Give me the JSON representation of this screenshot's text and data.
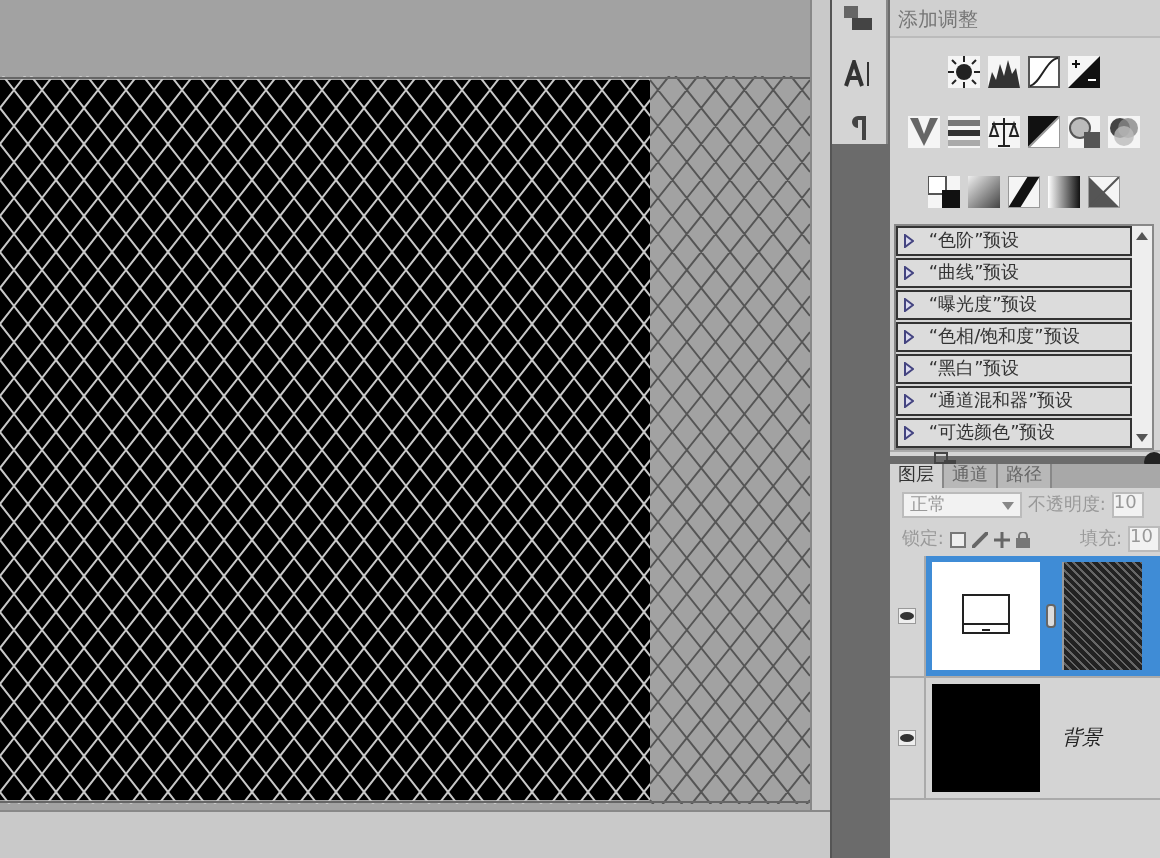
{
  "adjustments": {
    "title": "添加调整",
    "presets": [
      {
        "label": "“色阶”预设"
      },
      {
        "label": "“曲线”预设"
      },
      {
        "label": "“曝光度”预设"
      },
      {
        "label": "“色相/饱和度”预设"
      },
      {
        "label": "“黑白”预设"
      },
      {
        "label": "“通道混和器”预设"
      },
      {
        "label": "“可选颜色”预设"
      }
    ]
  },
  "layers_panel": {
    "tabs": [
      {
        "label": "图层",
        "selected": true
      },
      {
        "label": "通道",
        "selected": false
      },
      {
        "label": "路径",
        "selected": false
      }
    ],
    "blend_mode": "正常",
    "opacity_label": "不透明度:",
    "opacity_value": "10",
    "lock_label": "锁定:",
    "fill_label": "填充:",
    "fill_value": "10",
    "layers": [
      {
        "kind": "shape",
        "selected": true,
        "visible": true
      },
      {
        "kind": "background",
        "name": "背景",
        "selected": false,
        "visible": true
      }
    ]
  }
}
